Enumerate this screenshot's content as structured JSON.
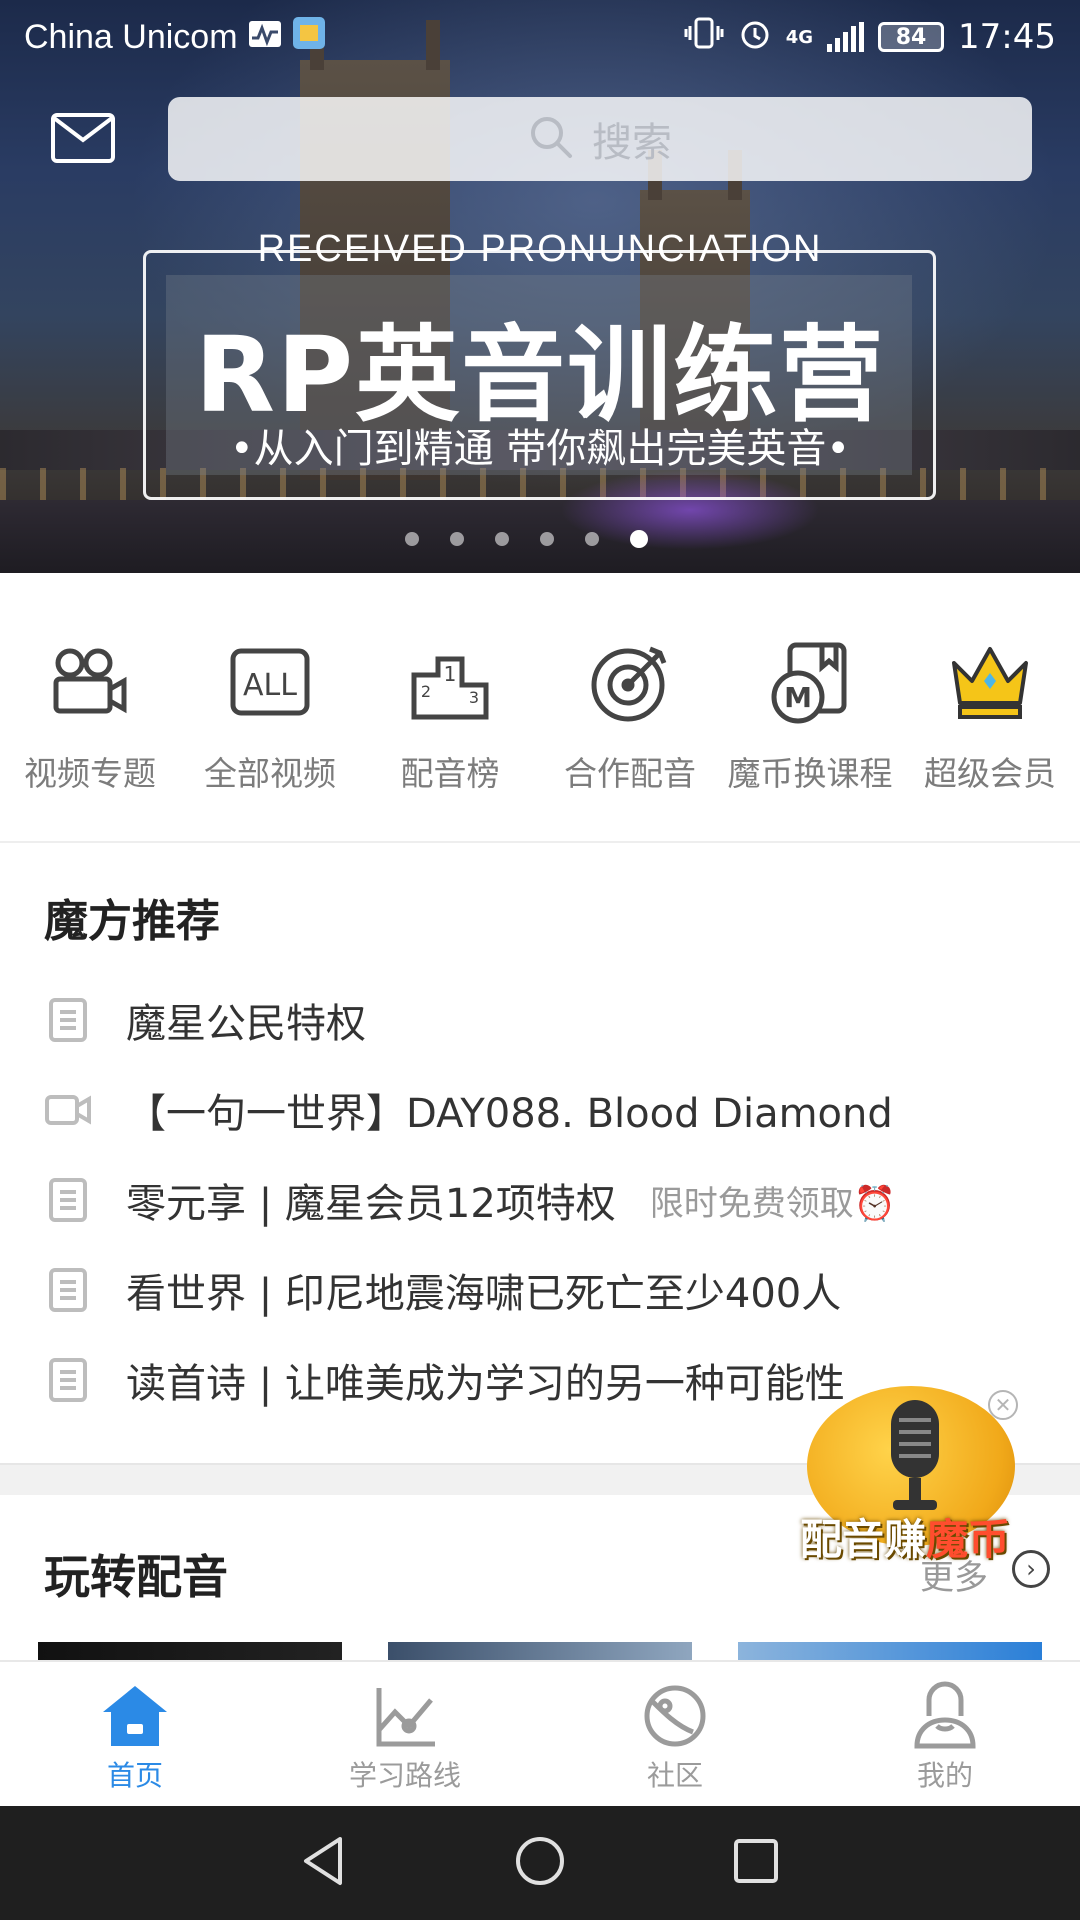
{
  "status_bar": {
    "carrier": "China Unicom",
    "network": "4G",
    "battery": "84",
    "time": "17:45"
  },
  "search": {
    "placeholder": "搜索"
  },
  "banner": {
    "subtitle": "RECEIVED PRONUNCIATION",
    "title": "RP英音训练营",
    "tagline": "•从入门到精通 带你飙出完美英音•",
    "dots_total": 6,
    "active_dot": 6
  },
  "quick_links": [
    {
      "label": "视频专题",
      "icon": "video-camera-icon"
    },
    {
      "label": "全部视频",
      "icon": "all-videos-icon"
    },
    {
      "label": "配音榜",
      "icon": "podium-icon"
    },
    {
      "label": "合作配音",
      "icon": "target-icon"
    },
    {
      "label": "魔币换课程",
      "icon": "coin-book-icon"
    },
    {
      "label": "超级会员",
      "icon": "crown-icon"
    }
  ],
  "recommend": {
    "title": "魔方推荐",
    "items": [
      {
        "text": "魔星公民特权",
        "icon": "article-icon",
        "tag": ""
      },
      {
        "text": "【一句一世界】DAY088. Blood Diamond",
        "icon": "video-icon",
        "tag": ""
      },
      {
        "text": "零元享 | 魔星会员12项特权",
        "icon": "article-icon",
        "tag": "限时免费领取⏰"
      },
      {
        "text": "看世界 | 印尼地震海啸已死亡至少400人",
        "icon": "article-icon",
        "tag": ""
      },
      {
        "text": "读首诗 | 让唯美成为学习的另一种可能性",
        "icon": "article-icon",
        "tag": ""
      }
    ]
  },
  "dubbing": {
    "title": "玩转配音",
    "more": "更多"
  },
  "float_badge": {
    "label_a": "配音赚",
    "label_b": "魔币"
  },
  "tabs": [
    {
      "label": "首页",
      "icon": "home-icon",
      "active": true
    },
    {
      "label": "学习路线",
      "icon": "learning-path-icon",
      "active": false
    },
    {
      "label": "社区",
      "icon": "community-planet-icon",
      "active": false
    },
    {
      "label": "我的",
      "icon": "profile-icon",
      "active": false
    }
  ],
  "colors": {
    "accent": "#2b8ae6",
    "crown": "#f5c518"
  }
}
